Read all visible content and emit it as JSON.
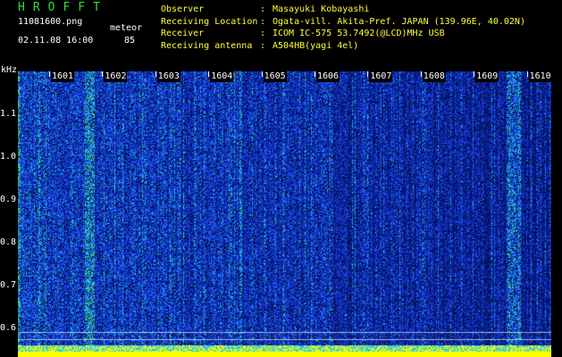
{
  "header": {
    "app_title": "HROFFT",
    "filename": "11081600.png",
    "datetime": "02.11.08 16:00",
    "meteor_label": "meteor",
    "meteor_count": "85"
  },
  "info": {
    "rows": [
      {
        "label": "Observer",
        "sep": ":",
        "value": "Masayuki Kobayashi"
      },
      {
        "label": "Receiving Location",
        "sep": ":",
        "value": "Ogata-vill. Akita-Pref. JAPAN (139.96E, 40.02N)"
      },
      {
        "label": "Receiver",
        "sep": ":",
        "value": "ICOM IC-575 53.7492(@LCD)MHz USB"
      },
      {
        "label": "Receiving antenna",
        "sep": ":",
        "value": "A504HB(yagi 4el)"
      }
    ]
  },
  "axis": {
    "unit": "kHz",
    "ticks": [
      "1.1",
      "1.0",
      "0.9",
      "0.8",
      "0.7",
      "0.6"
    ],
    "tick_values": [
      1.1,
      1.0,
      0.9,
      0.8,
      0.7,
      0.6
    ],
    "range": [
      0.57,
      1.2
    ]
  },
  "time_axis": {
    "labels": [
      "1601",
      "1602",
      "1603",
      "1604",
      "1605",
      "1606",
      "1607",
      "1608",
      "1609",
      "1610"
    ]
  },
  "colors": {
    "header_green": "#33dd33",
    "info_yellow": "#ffff33",
    "background_blue": "#06125a",
    "noise_bright": "#2a5cff",
    "signal_cyan": "#22ccee",
    "signal_green": "#44ee66",
    "baseline_yellow": "#ffff00"
  }
}
